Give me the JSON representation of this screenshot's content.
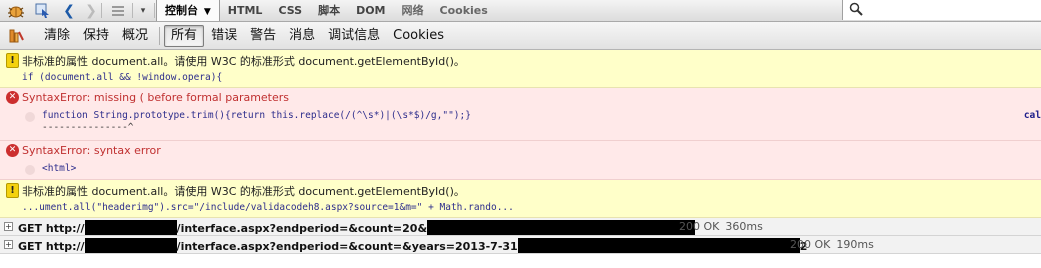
{
  "toolbar": {
    "icons": [
      "firebug-icon",
      "inspect-icon",
      "back-icon",
      "forward-icon",
      "menu-icon",
      "dropdown-icon"
    ],
    "tabs": [
      "控制台",
      "HTML",
      "CSS",
      "脚本",
      "DOM",
      "网络",
      "Cookies"
    ],
    "active_tab_arrow": "▼",
    "search_placeholder": ""
  },
  "filters": {
    "items": [
      "清除",
      "保持",
      "概况",
      "所有",
      "错误",
      "警告",
      "消息",
      "调试信息",
      "Cookies"
    ],
    "active": "所有"
  },
  "logs": [
    {
      "type": "warning",
      "message": "非标准的属性 document.all。请使用 W3C 的标准形式 document.getElementById()。",
      "code": "if (document.all && !window.opera){"
    },
    {
      "type": "error",
      "message": "SyntaxError: missing ( before formal parameters",
      "code": "function String.prototype.trim(){return this.replace(/(^\\s*)|(\\s*$)/g,\"\");}",
      "pointer": "---------------^",
      "source": "cal"
    },
    {
      "type": "error",
      "message": "SyntaxError: syntax error",
      "code": "<html>"
    },
    {
      "type": "warning",
      "message": "非标准的属性 document.all。请使用 W3C 的标准形式 document.getElementById()。",
      "code": "...ument.all(\"headerimg\").src=\"/include/validacodeh8.aspx?source=1&m=\" + Math.rando..."
    }
  ],
  "network": [
    {
      "method": "GET",
      "prefix": "http://",
      "path": "/interface.aspx?endperiod=&count=20&",
      "status": "200 OK",
      "time": "360ms"
    },
    {
      "method": "GET",
      "prefix": "http://",
      "path": "/interface.aspx?endperiod=&count=&years=2013-7-31",
      "suffix": "2",
      "status": "200 OK",
      "time": "190ms"
    }
  ]
}
